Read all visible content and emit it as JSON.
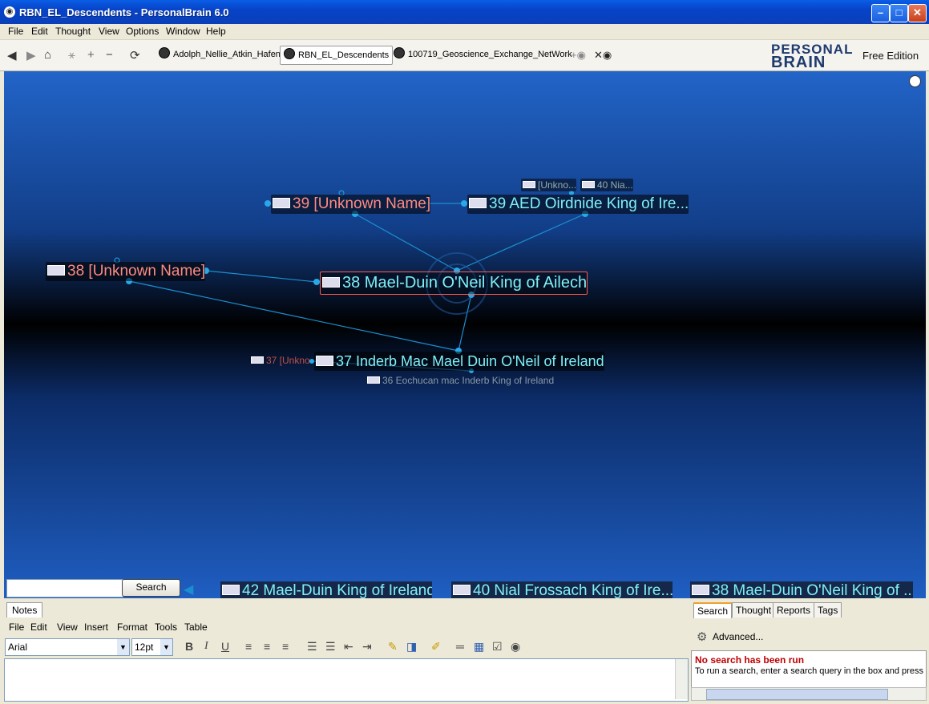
{
  "window": {
    "title": "RBN_EL_Descendents - PersonalBrain 6.0"
  },
  "menu": [
    "File",
    "Edit",
    "Thought",
    "View",
    "Options",
    "Window",
    "Help"
  ],
  "tabs": [
    {
      "label": "Adolph_Nellie_Atkin_Hafen"
    },
    {
      "label": "RBN_EL_Descendents"
    },
    {
      "label": "100719_Geoscience_Exchange_NetWork"
    }
  ],
  "brand": {
    "line1": "PERSONAL",
    "line2": "BRAIN",
    "edition": "Free Edition"
  },
  "thoughts": {
    "active": "38 Mael-Duin O'Neil King of Ailech",
    "parent_left": "39 [Unknown Name]",
    "parent_right": "39 AED Oirdnide King of Ire...",
    "gp_small1": "[Unkno...",
    "gp_small2": "40 Nia...",
    "jump": "38 [Unknown Name]",
    "child": "37 Inderb Mac Mael Duin O'Neil of Ireland",
    "child_small": "37 [Unkno",
    "grandchild": "36 Eochucan mac Inderb King of Ireland"
  },
  "search": {
    "value": "",
    "button": "Search"
  },
  "pins": [
    {
      "label": "42 Mael-Duin King of Ireland"
    },
    {
      "label": "40 Nial Frossach King of Ire..."
    },
    {
      "label": "38 Mael-Duin O'Neil King of ..."
    }
  ],
  "notes": {
    "tab": "Notes",
    "menu": [
      "File",
      "Edit",
      "View",
      "Insert",
      "Format",
      "Tools",
      "Table"
    ],
    "font": "Arial",
    "size": "12pt",
    "bold": "B",
    "italic": "I",
    "underline": "U"
  },
  "right_panel": {
    "tabs": [
      "Search",
      "Thought",
      "Reports",
      "Tags"
    ],
    "advanced": "Advanced...",
    "status_title": "No search has been run",
    "status_text": "To run a search, enter a search query in the box and press"
  },
  "colors": {
    "plex_top": "#2264c8",
    "thought_text": "#7ff0f8",
    "unknown_text": "#ff8a80",
    "active_border": "#ff5a4a"
  }
}
